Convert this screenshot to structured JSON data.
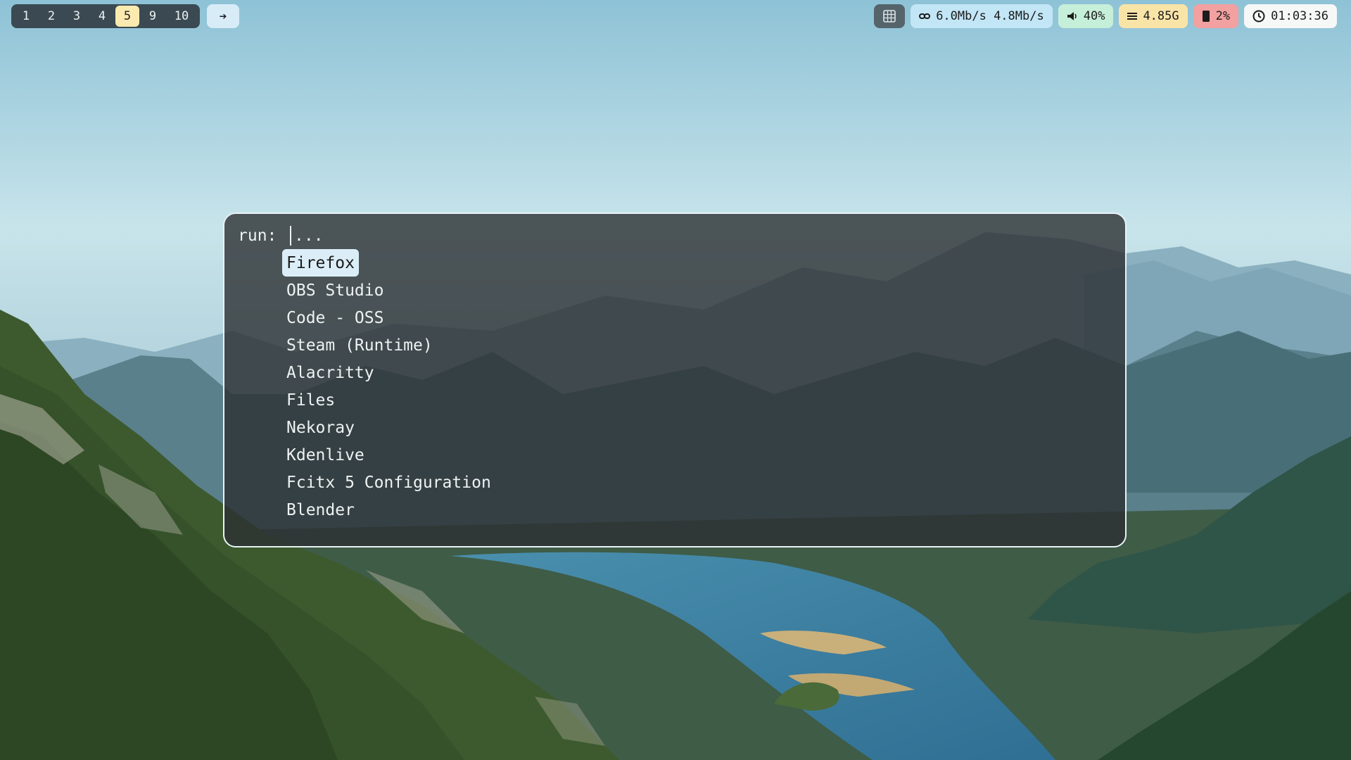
{
  "workspaces": {
    "items": [
      "1",
      "2",
      "3",
      "4",
      "5",
      "9",
      "10"
    ],
    "active": "5"
  },
  "bar": {
    "arrow_icon": "arrow-right-icon",
    "tray_icon": "tray-grid-icon",
    "network": {
      "icon": "link-icon",
      "text": "6.0Mb/s 4.8Mb/s"
    },
    "volume": {
      "icon": "speaker-icon",
      "text": "40%"
    },
    "memory": {
      "icon": "memory-bars-icon",
      "text": "4.85G"
    },
    "cpu": {
      "icon": "cpu-chip-icon",
      "text": "2%"
    },
    "clock": {
      "icon": "clock-icon",
      "text": "01:03:36"
    }
  },
  "launcher": {
    "prompt": "run:",
    "placeholder": "...",
    "value": "",
    "selected_index": 0,
    "items": [
      "Firefox",
      "OBS Studio",
      "Code - OSS",
      "Steam (Runtime)",
      "Alacritty",
      "Files",
      "Nekoray",
      "Kdenlive",
      "Fcitx 5 Configuration",
      "Blender"
    ]
  },
  "colors": {
    "active_workspace": "#fbeaaf",
    "network": "#c2e6f6",
    "volume": "#c6efd9",
    "memory": "#f9e4a8",
    "cpu": "#f2a0a0",
    "clock": "#f6f7f7",
    "launcher_border": "#e8f2f5",
    "selection": "#dbeef8"
  }
}
